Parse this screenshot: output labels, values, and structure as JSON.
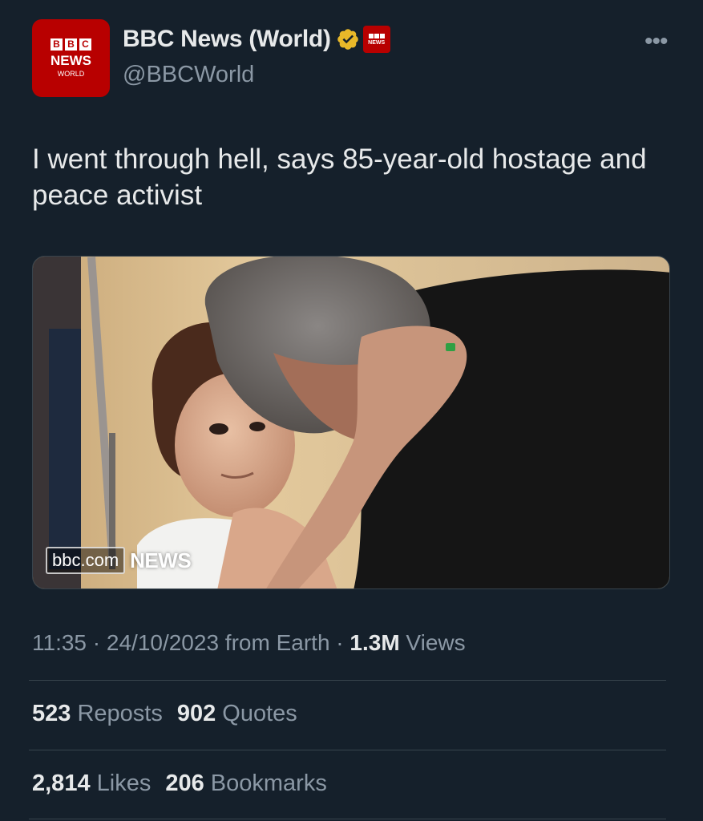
{
  "account": {
    "display_name": "BBC News (World)",
    "handle": "@BBCWorld",
    "avatar": {
      "blocks": [
        "B",
        "B",
        "C"
      ],
      "line1": "NEWS",
      "line2": "WORLD"
    },
    "verified_icon": "gold-verified-badge",
    "affiliate_badge_text": "NEWS"
  },
  "more_icon": "•••",
  "tweet": {
    "text": "I went through hell, says 85-year-old hostage and peace activist"
  },
  "media": {
    "watermark_url": "bbc.com",
    "watermark_brand": "NEWS"
  },
  "meta": {
    "time": "11:35",
    "sep1": " · ",
    "date": "24/10/2023",
    "source": " from Earth",
    "sep2": " · ",
    "views_count": "1.3M",
    "views_label": " Views"
  },
  "stats": {
    "reposts_count": "523",
    "reposts_label": "Reposts",
    "quotes_count": "902",
    "quotes_label": "Quotes",
    "likes_count": "2,814",
    "likes_label": "Likes",
    "bookmarks_count": "206",
    "bookmarks_label": "Bookmarks"
  },
  "colors": {
    "background": "#15202b",
    "text_primary": "#e7e9ea",
    "text_secondary": "#8b98a5",
    "bbc_red": "#b80000",
    "verified_gold": "#e8b829"
  }
}
